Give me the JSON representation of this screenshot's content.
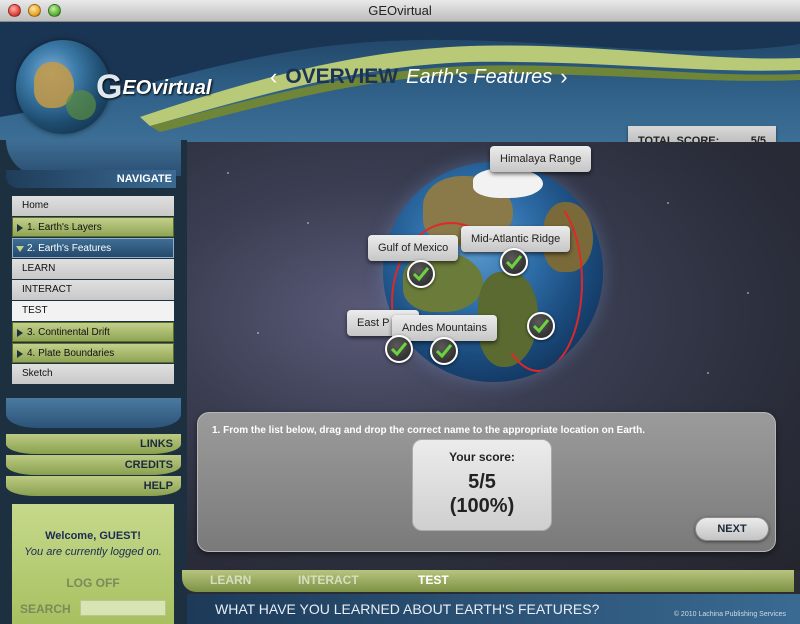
{
  "window": {
    "title": "GEOvirtual"
  },
  "header": {
    "logo_letter": "G",
    "logo_text": "EO",
    "logo_suffix": "virtual",
    "nav_prev": "‹",
    "nav_next": "›",
    "section": "OVERVIEW",
    "topic": "Earth's Features",
    "total_score_label": "TOTAL SCORE:",
    "total_score_value": "5/5"
  },
  "sidebar": {
    "navigate_label": "NAVIGATE",
    "items": [
      {
        "label": "Home"
      },
      {
        "label": "1. Earth's Layers"
      },
      {
        "label": "2. Earth's Features"
      },
      {
        "label": "LEARN"
      },
      {
        "label": "INTERACT"
      },
      {
        "label": "TEST"
      },
      {
        "label": "3. Continental Drift"
      },
      {
        "label": "4. Plate Boundaries"
      },
      {
        "label": "Sketch"
      }
    ],
    "links": [
      "LINKS",
      "CREDITS",
      "HELP"
    ],
    "welcome": "Welcome, GUEST!",
    "logged_in": "You are currently logged on.",
    "logoff": "LOG OFF",
    "search_label": "SEARCH",
    "search_value": ""
  },
  "stage": {
    "labels": {
      "himalaya": "Himalaya Range",
      "mid_atlantic": "Mid-Atlantic Ridge",
      "gulf": "Gulf of Mexico",
      "east_pacific": "East P",
      "andes": "Andes Mountains"
    },
    "question": "1. From the list below, drag and drop the correct name to the appropriate location on Earth.",
    "score_label": "Your score:",
    "score_value": "5/5",
    "score_percent": "(100%)",
    "next": "NEXT"
  },
  "tabs": [
    "LEARN",
    "INTERACT",
    "TEST"
  ],
  "footer": {
    "question": "WHAT HAVE YOU LEARNED ABOUT EARTH'S FEATURES?",
    "copyright": "© 2010 Lachina Publishing Services"
  },
  "colors": {
    "accent_green": "#b7c47e",
    "header_blue": "#2f5f86",
    "ridge_red": "#e02828"
  }
}
